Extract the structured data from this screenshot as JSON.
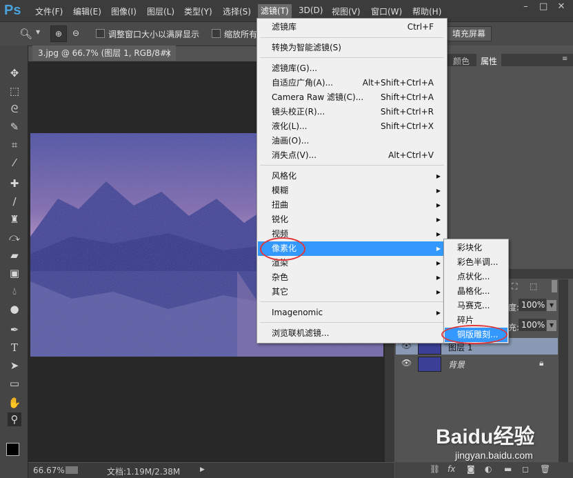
{
  "app": {
    "logo": "Ps"
  },
  "menubar": {
    "items": [
      "文件(F)",
      "编辑(E)",
      "图像(I)",
      "图层(L)",
      "类型(Y)",
      "选择(S)",
      "滤镜(T)",
      "3D(D)",
      "视图(V)",
      "窗口(W)",
      "帮助(H)"
    ],
    "window_buttons": {
      "minimize": "–",
      "restore": "□",
      "close": "✕"
    }
  },
  "options": {
    "check1_label": "调整窗口大小以满屏显示",
    "check2_label": "缩放所有",
    "fill_screen": "填充屏幕"
  },
  "document": {
    "tab_title": "3.jpg @ 66.7% (图层 1, RGB/8#) *",
    "tab_close": "×"
  },
  "status": {
    "zoom": "66.67%",
    "doc_info": "文档:1.19M/2.38M"
  },
  "panel": {
    "tabs": [
      "颜色",
      "属性"
    ],
    "opacity_label": "度:",
    "opacity_value": "100%",
    "fill_label": "充:",
    "fill_value": "100%",
    "layers": [
      {
        "name": "图层 1",
        "selected": true
      },
      {
        "name": "背景",
        "locked": true
      }
    ]
  },
  "filter_menu": {
    "groups": [
      [
        {
          "label": "滤镜库",
          "shortcut": "Ctrl+F"
        }
      ],
      [
        {
          "label": "转换为智能滤镜(S)",
          "shortcut": ""
        }
      ],
      [
        {
          "label": "滤镜库(G)...",
          "shortcut": ""
        },
        {
          "label": "自适应广角(A)...",
          "shortcut": "Alt+Shift+Ctrl+A"
        },
        {
          "label": "Camera Raw 滤镜(C)...",
          "shortcut": "Shift+Ctrl+A"
        },
        {
          "label": "镜头校正(R)...",
          "shortcut": "Shift+Ctrl+R"
        },
        {
          "label": "液化(L)...",
          "shortcut": "Shift+Ctrl+X"
        },
        {
          "label": "油画(O)...",
          "shortcut": ""
        },
        {
          "label": "消失点(V)...",
          "shortcut": "Alt+Ctrl+V"
        }
      ],
      [
        {
          "label": "风格化",
          "submenu": true
        },
        {
          "label": "模糊",
          "submenu": true
        },
        {
          "label": "扭曲",
          "submenu": true
        },
        {
          "label": "锐化",
          "submenu": true
        },
        {
          "label": "视频",
          "submenu": true
        },
        {
          "label": "像素化",
          "submenu": true,
          "highlighted": true
        },
        {
          "label": "渲染",
          "submenu": true
        },
        {
          "label": "杂色",
          "submenu": true
        },
        {
          "label": "其它",
          "submenu": true
        }
      ],
      [
        {
          "label": "Imagenomic",
          "submenu": true
        }
      ],
      [
        {
          "label": "浏览联机滤镜...",
          "shortcut": ""
        }
      ]
    ]
  },
  "pixelate_submenu": [
    "彩块化",
    "彩色半调...",
    "点状化...",
    "晶格化...",
    "马赛克...",
    "碎片",
    "铜版雕刻..."
  ],
  "watermark": {
    "brand": "Baidu经验",
    "url": "jingyan.baidu.com"
  },
  "colors": {
    "highlight": "#3399ff",
    "annotation_ring": "#e0363a"
  }
}
